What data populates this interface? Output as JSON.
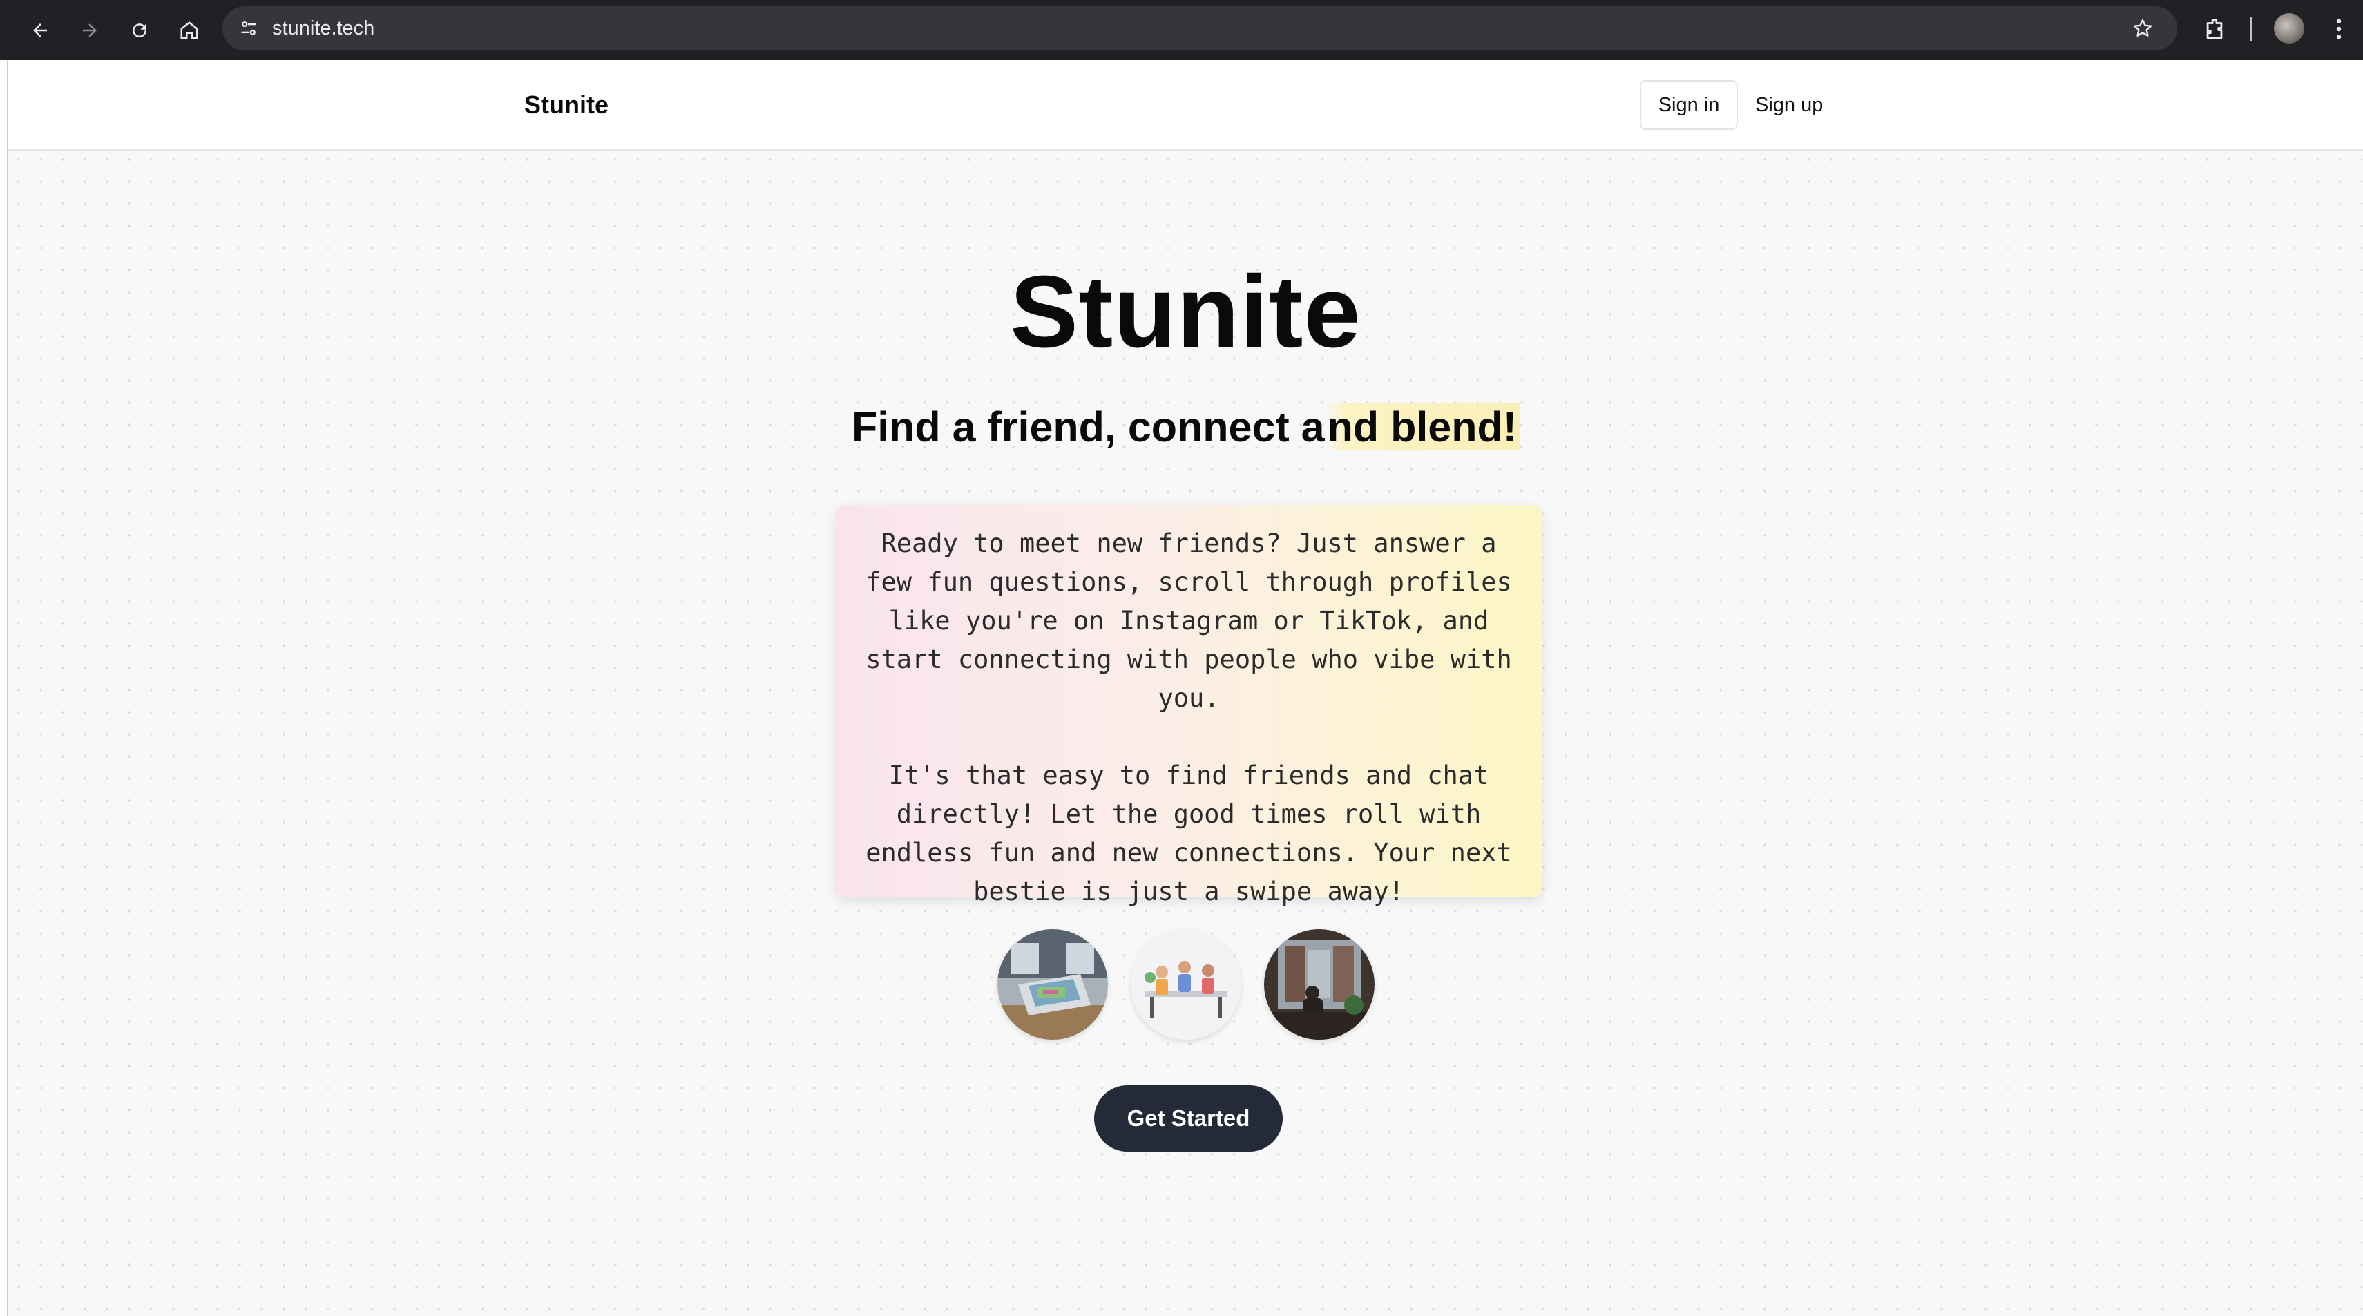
{
  "browser": {
    "url": "stunite.tech",
    "icons": [
      "back-arrow-icon",
      "forward-arrow-icon",
      "reload-icon",
      "home-icon",
      "site-info-icon",
      "bookmark-star-icon",
      "extensions-icon",
      "profile-avatar",
      "kebab-menu-icon"
    ]
  },
  "header": {
    "brand": "Stunite",
    "signin_label": "Sign in",
    "signup_label": "Sign up"
  },
  "hero": {
    "title": "Stunite",
    "tagline_part1": "Find a friend, connect a",
    "tagline_highlight": "nd blend!",
    "description_p1": "Ready to meet new friends? Just answer a few fun questions, scroll through profiles like you're on Instagram or TikTok, and start connecting with people who vibe with you.",
    "description_p2": "It's that easy to find friends and chat directly! Let the good times roll with endless fun and new connections. Your next bestie is just a swipe away!",
    "cta_label": "Get Started"
  },
  "colors": {
    "chrome_bg": "#202124",
    "omnibox_bg": "#35363a",
    "cta_bg": "#242a38",
    "highlight": "#fbefb8"
  }
}
